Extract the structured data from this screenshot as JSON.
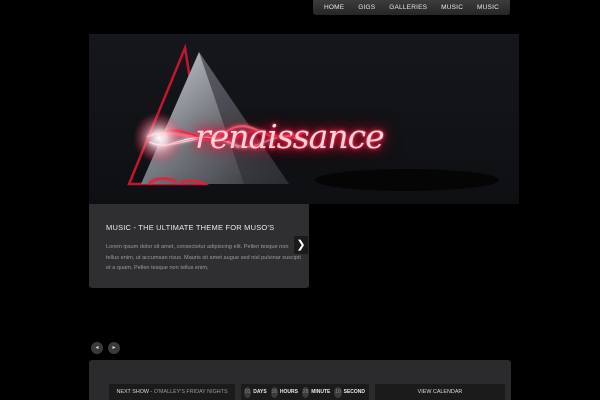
{
  "nav": {
    "items": [
      "HOME",
      "GIGS",
      "GALLERIES",
      "MUSIC",
      "MUSIC"
    ]
  },
  "hero": {
    "brand_text": "renaissance",
    "accent_color": "#ff2048"
  },
  "caption": {
    "title": "MUSIC - THE ULTIMATE THEME FOR MUSO'S",
    "body": "Lorem ipsum dolor sit amet, consectetur adipiscing elit. Pellen tesque non tellus enim, ut accumsan risus. Mauris sit amet augue sed nisl pulvinar suscipit et a quam. Pellen tesque non tellus enim,"
  },
  "slider": {
    "next_glyph": "❯",
    "prev_glyph": "◂",
    "next_small_glyph": "▸"
  },
  "footer": {
    "next_show_label": "NEXT SHOW -",
    "next_show_venue": "O'MALLEY'S FRIDAY NIGHTS",
    "countdown": {
      "days_value": "01",
      "days_label": "DAYS",
      "hours_value": "16",
      "hours_label": "HOURS",
      "minute_value": "28",
      "minute_label": "MINUTE",
      "second_value": "10",
      "second_label": "SECOND"
    },
    "calendar_label": "VIEW CALENDAR"
  }
}
